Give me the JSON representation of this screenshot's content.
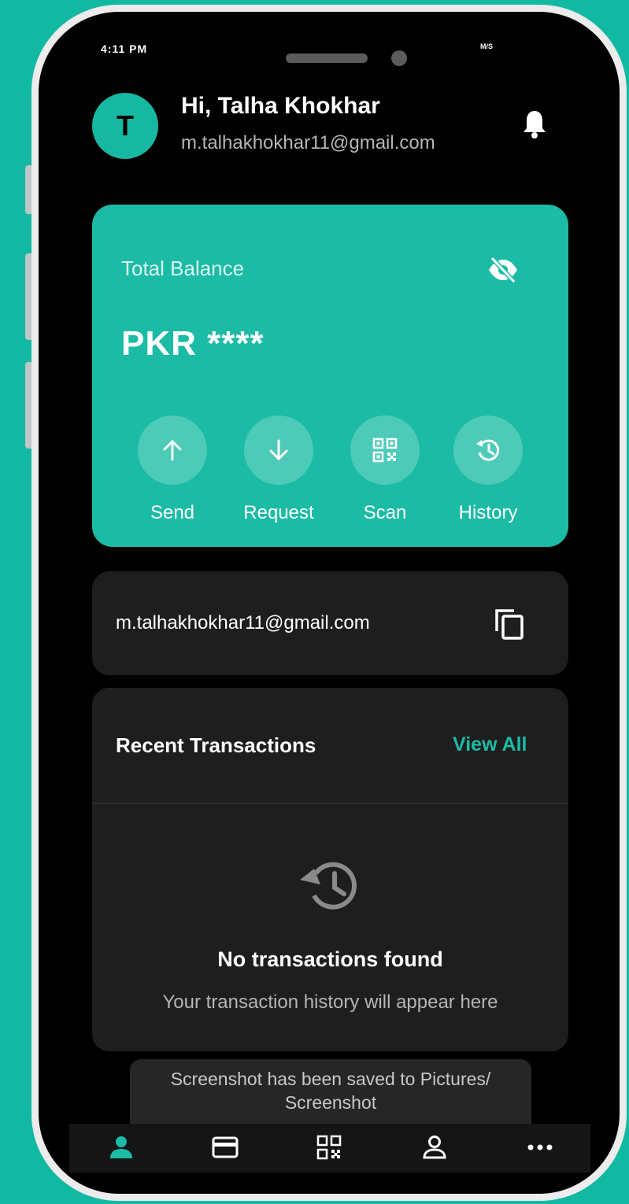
{
  "status_bar": {
    "time": "4:11 PM",
    "indicators": "M/S"
  },
  "header": {
    "avatar_initial": "T",
    "greeting": "Hi, Talha Khokhar",
    "email": "m.talhakhokhar11@gmail.com",
    "icon": "bell-icon"
  },
  "balance": {
    "label": "Total Balance",
    "amount": "PKR ****",
    "visibility_icon": "eye-off-icon",
    "actions": [
      {
        "label": "Send",
        "icon": "arrow-up-icon"
      },
      {
        "label": "Request",
        "icon": "arrow-down-icon"
      },
      {
        "label": "Scan",
        "icon": "qr-code-icon"
      },
      {
        "label": "History",
        "icon": "history-icon"
      }
    ]
  },
  "account": {
    "email": "m.talhakhokhar11@gmail.com",
    "icon": "copy-icon"
  },
  "transactions": {
    "title": "Recent Transactions",
    "view_all": "View All",
    "empty_title": "No transactions found",
    "empty_subtitle": "Your transaction history will appear here"
  },
  "toast": {
    "message": "Screenshot has been saved to  Pictures/ Screenshot"
  },
  "bottom_nav": [
    "home-icon",
    "card-icon",
    "qr-code-icon",
    "profile-icon",
    "more-icon"
  ],
  "colors": {
    "accent": "#1bbba5",
    "background": "#12b9a2",
    "card": "#1e1e1e"
  }
}
